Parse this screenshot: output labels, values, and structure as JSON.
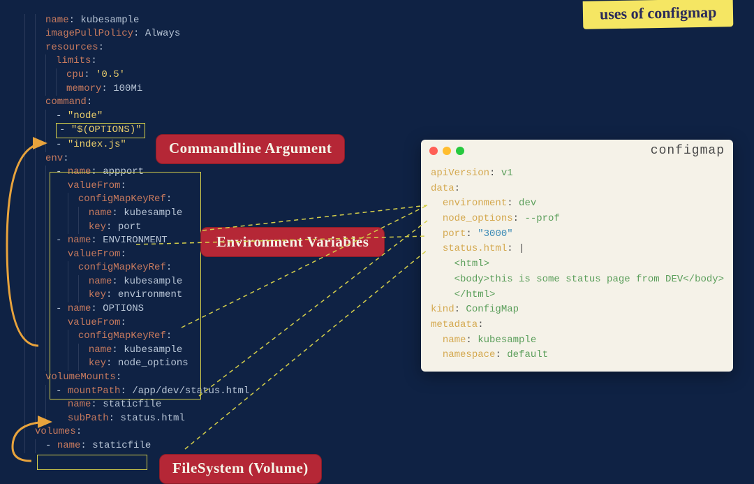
{
  "sticky": {
    "text": "uses of configmap"
  },
  "callouts": {
    "cmd": "Commandline Argument",
    "env": "Environment Variables",
    "fs": "FileSystem (Volume)"
  },
  "pod": {
    "name_key": "name",
    "name_val": "kubesample",
    "ipp_key": "imagePullPolicy",
    "ipp_val": "Always",
    "res_key": "resources",
    "limits_key": "limits",
    "cpu_key": "cpu",
    "cpu_val": "'0.5'",
    "mem_key": "memory",
    "mem_val": "100Mi",
    "cmd_key": "command",
    "cmd0": "\"node\"",
    "cmd1": "\"$(OPTIONS)\"",
    "cmd2": "\"index.js\"",
    "env_key": "env",
    "env0_name": "appport",
    "vf_key": "valueFrom",
    "cmr_key": "configMapKeyRef",
    "nm_key": "name",
    "key_key": "key",
    "env0_key": "port",
    "env1_name": "ENVIRONMENT",
    "env1_key": "environment",
    "env2_name": "OPTIONS",
    "env2_key": "node_options",
    "vm_key": "volumeMounts",
    "mp_key": "mountPath",
    "mp_val": "/app/dev/status.html",
    "vm_name": "staticfile",
    "sp_key": "subPath",
    "sp_val": "status.html",
    "vols_key": "volumes",
    "vol0_name": "staticfile"
  },
  "cm": {
    "title": "configmap",
    "api_key": "apiVersion",
    "api_val": "v1",
    "data_key": "data",
    "env_key": "environment",
    "env_val": "dev",
    "nopt_key": "node_options",
    "nopt_val": "--prof",
    "port_key": "port",
    "port_val": "\"3000\"",
    "status_key": "status.html",
    "pipe": "|",
    "html1": "<html>",
    "html2": "<body>this is some status page from DEV</body>",
    "html3": "</html>",
    "kind_key": "kind",
    "kind_val": "ConfigMap",
    "meta_key": "metadata",
    "mname_key": "name",
    "mname_val": "kubesample",
    "ns_key": "namespace",
    "ns_val": "default"
  }
}
